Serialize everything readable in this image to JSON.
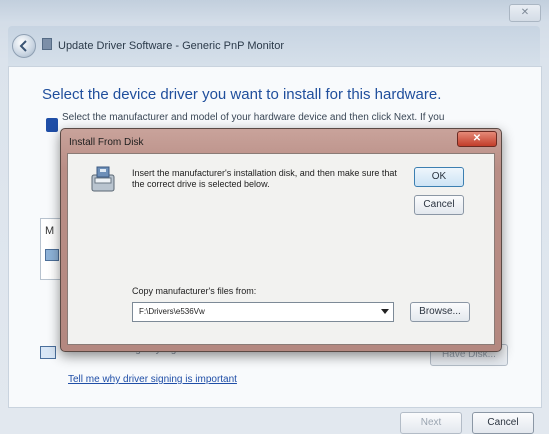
{
  "outer": {
    "close_label": "✕",
    "header_title": "Update Driver Software - Generic PnP Monitor",
    "heading": "Select the device driver you want to install for this hardware.",
    "subtext": "Select the manufacturer and model of your hardware device and then click Next. If you",
    "subtext_suffix": "you",
    "list_initial": "M",
    "signed_text": "This driver is digitally signed.",
    "signing_link": "Tell me why driver signing is important",
    "have_disk_label": "Have Disk...",
    "next_label": "Next",
    "cancel_label": "Cancel"
  },
  "dialog": {
    "title": "Install From Disk",
    "close_label": "✕",
    "instructions": "Insert the manufacturer's installation disk, and then make sure that the correct drive is selected below.",
    "ok_label": "OK",
    "cancel_label": "Cancel",
    "copy_label": "Copy manufacturer's files from:",
    "path_value": "F:\\Drivers\\e536Vw",
    "browse_label": "Browse..."
  }
}
